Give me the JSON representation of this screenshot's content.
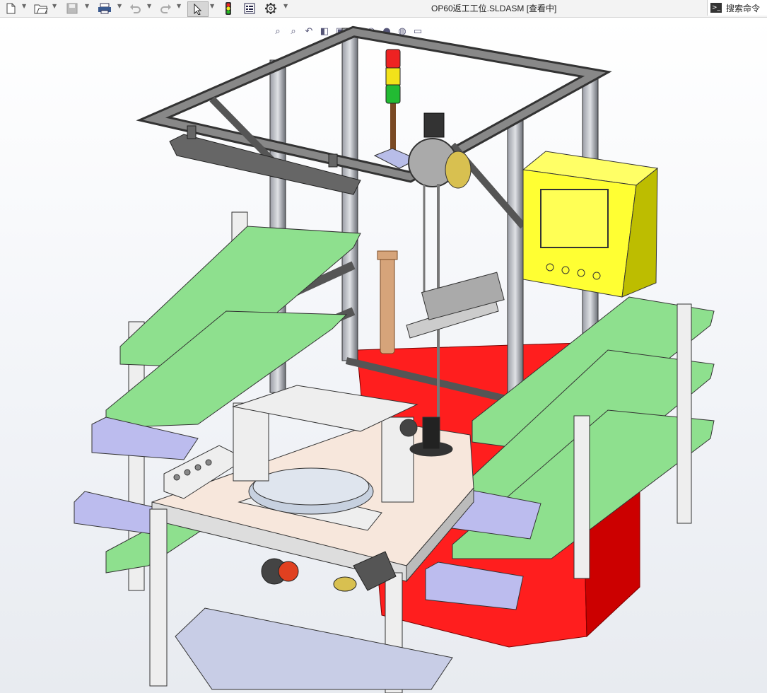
{
  "window": {
    "title": "OP60返工工位.SLDASM [查看中]"
  },
  "search": {
    "label": "搜索命令"
  },
  "toolbar": {
    "icons": [
      "new-document-icon",
      "open-folder-icon",
      "save-icon",
      "print-icon",
      "undo-icon",
      "redo-icon",
      "select-pointer-icon",
      "rebuild-traffic-light-icon",
      "file-properties-icon",
      "options-gear-icon"
    ]
  },
  "heads_up_view": {
    "icons": [
      "zoom-to-fit-icon",
      "zoom-to-area-icon",
      "previous-view-icon",
      "section-view-icon",
      "view-orientation-icon",
      "display-style-icon",
      "hide-show-items-icon",
      "edit-appearance-icon",
      "apply-scene-icon",
      "view-settings-icon"
    ]
  },
  "model": {
    "name": "OP60返工工位",
    "colors": {
      "frame": "#7a7e86",
      "bin_green": "#8ee08e",
      "bin_blue": "#bcbcee",
      "cabinet_red": "#ff2020",
      "control_box": "#ffff33",
      "table_top": "#f7e7dc",
      "base_plate": "#c8cde6",
      "column": "#d6a47a",
      "beacon_red": "#ee2222",
      "beacon_yellow": "#f2e21a",
      "beacon_green": "#22bb33"
    }
  }
}
